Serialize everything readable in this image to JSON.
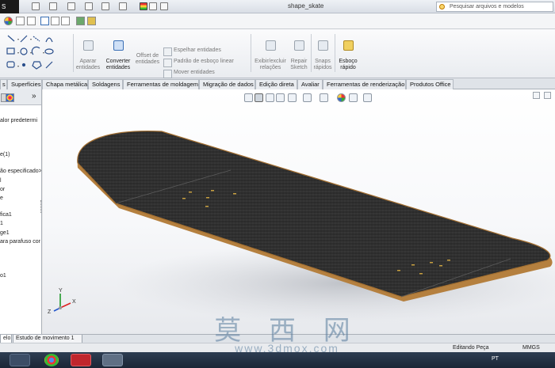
{
  "titlebar": {
    "logo": "S",
    "document_title": "shape_skate",
    "search_placeholder": "Pesquisar arquivos e modelos"
  },
  "command_manager": {
    "aparar": "Aparar\nentidades",
    "converter": "Converter\nentidades",
    "offset": "Offset de\nentidades",
    "espelhar": "Espelhar entidades",
    "padrao": "Padrão de esboço linear",
    "mover": "Mover entidades",
    "exibir": "Exibir/excluir\nrelações",
    "repair": "Repair\nSketch",
    "snaps": "Snaps\nrápidos",
    "esboco_rapido": "Esboço\nrápido"
  },
  "tabs": [
    {
      "label": "s"
    },
    {
      "label": "Superfícies"
    },
    {
      "label": "Chapa metálica"
    },
    {
      "label": "Soldagens"
    },
    {
      "label": "Ferramentas de moldagem"
    },
    {
      "label": "Migração de dados"
    },
    {
      "label": "Edição direta"
    },
    {
      "label": "Avaliar"
    },
    {
      "label": "Ferramentas de renderização"
    },
    {
      "label": "Produtos Office"
    }
  ],
  "left_panel": {
    "collapse_label": "»",
    "tree": [
      "alor predetermi",
      "e(1)",
      "ão especificado>",
      "l",
      "or",
      "e",
      "fica1",
      "1",
      "ge1",
      "ara parafuso cor",
      "o1"
    ]
  },
  "viewport": {
    "triad_x": "X",
    "triad_y": "Y",
    "triad_z": "Z"
  },
  "bottom_tabs": [
    {
      "label": "elo"
    },
    {
      "label": "Estudo de movimento 1"
    }
  ],
  "status": {
    "mode": "Editando Peça",
    "units": "MMGS"
  },
  "taskbar": {
    "language": "PT"
  },
  "watermark": {
    "chinese": "莫 西 网",
    "url": "www.3dmox.com"
  },
  "colors": {
    "griptape": "#2b2b2b",
    "wood": "#b07a3a",
    "accent": "#3a6fb5"
  }
}
